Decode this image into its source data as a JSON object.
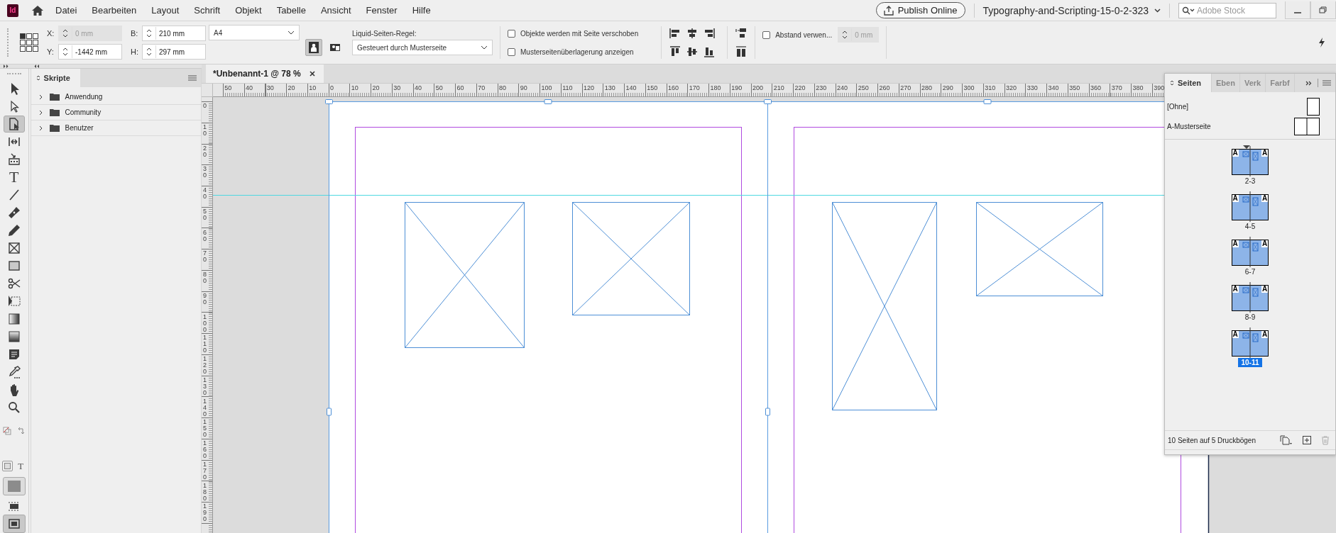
{
  "app_icon": {
    "label": "Id"
  },
  "menu": [
    "Datei",
    "Bearbeiten",
    "Layout",
    "Schrift",
    "Objekt",
    "Tabelle",
    "Ansicht",
    "Fenster",
    "Hilfe"
  ],
  "publish_button": "Publish Online",
  "document_switcher": "Typography-and-Scripting-15-0-2-323",
  "search": {
    "placeholder": "Adobe Stock"
  },
  "control_panel": {
    "fields": [
      {
        "label": "X:",
        "value": "0 mm",
        "disabled": true
      },
      {
        "label": "Y:",
        "value": "-1442 mm",
        "disabled": false
      },
      {
        "label": "B:",
        "value": "210 mm",
        "disabled": false
      },
      {
        "label": "H:",
        "value": "297 mm",
        "disabled": false
      }
    ],
    "preset": "A4",
    "orientation": [
      {
        "kind": "portrait",
        "selected": true
      },
      {
        "kind": "landscape",
        "selected": false
      }
    ],
    "liquid_label": "Liquid-Seiten-Regel:",
    "liquid_rule": "Gesteuert durch Musterseite",
    "options": [
      {
        "label": "Objekte werden mit Seite verschoben",
        "checked": false
      },
      {
        "label": "Musterseitenüberlagerung anzeigen",
        "checked": false
      }
    ],
    "spacing": {
      "label": "Abstand verwen...",
      "checked": false,
      "value": "0 mm",
      "disabled": true
    }
  },
  "tools": [
    {
      "kind": "selection",
      "selected": false
    },
    {
      "kind": "direct-selection",
      "selected": false
    },
    {
      "kind": "page",
      "selected": true
    },
    {
      "kind": "gap",
      "selected": false
    },
    {
      "kind": "content-collector",
      "selected": false
    },
    {
      "kind": "type",
      "glyph": "T",
      "selected": false
    },
    {
      "kind": "line",
      "selected": false
    },
    {
      "kind": "pen",
      "selected": false
    },
    {
      "kind": "pencil",
      "selected": false
    },
    {
      "kind": "rectangle-frame",
      "selected": false
    },
    {
      "kind": "rectangle",
      "selected": false
    },
    {
      "kind": "scissors",
      "selected": false
    },
    {
      "kind": "free-transform",
      "selected": false
    },
    {
      "kind": "gradient",
      "selected": false
    },
    {
      "kind": "gradient-feather",
      "selected": false
    },
    {
      "kind": "note",
      "selected": false
    },
    {
      "kind": "eyedropper",
      "selected": false
    },
    {
      "kind": "hand",
      "selected": false
    },
    {
      "kind": "zoom",
      "selected": false
    }
  ],
  "format_toggle": [
    {
      "kind": "container",
      "selected": true
    },
    {
      "kind": "text",
      "glyph": "T",
      "selected": false
    }
  ],
  "screen_mode": {
    "selected": true
  },
  "scripts_panel": {
    "tab": "Skripte",
    "items": [
      {
        "label": "Anwendung",
        "expanded": false
      },
      {
        "label": "Community",
        "expanded": false
      },
      {
        "label": "Benutzer",
        "expanded": false
      }
    ]
  },
  "document_tab": {
    "title": "*Unbenannt-1 @ 78 %"
  },
  "rulers": {
    "horizontal": [
      "50",
      "40",
      "30",
      "20",
      "10",
      "0",
      "10",
      "20",
      "30",
      "40",
      "50",
      "60",
      "70",
      "80",
      "90",
      "100",
      "110",
      "120",
      "130",
      "140",
      "150",
      "160",
      "170",
      "180",
      "190",
      "200",
      "210",
      "220",
      "230",
      "240",
      "250",
      "260",
      "270",
      "280",
      "290",
      "300",
      "310",
      "320",
      "330",
      "340",
      "350",
      "360",
      "370",
      "380",
      "390"
    ],
    "vertical": [
      "0",
      "10",
      "20",
      "30",
      "40",
      "50",
      "60",
      "70",
      "80",
      "90",
      "100",
      "110",
      "120",
      "130",
      "140",
      "150",
      "160",
      "170",
      "180",
      "190"
    ]
  },
  "pages_panel": {
    "tabs": [
      {
        "label": "Seiten",
        "selected": true
      },
      {
        "label": "Eben",
        "selected": false
      },
      {
        "label": "Verk",
        "selected": false
      },
      {
        "label": "Farbf",
        "selected": false
      }
    ],
    "masters": [
      {
        "label": "[Ohne]",
        "kind": "single"
      },
      {
        "label": "A-Musterseite",
        "kind": "spread"
      }
    ],
    "spreads": [
      {
        "label": "2-3",
        "master_letters": [
          "A",
          "A"
        ],
        "pointer": true,
        "selected": false
      },
      {
        "label": "4-5",
        "master_letters": [
          "A",
          "A"
        ],
        "pointer": false,
        "selected": false
      },
      {
        "label": "6-7",
        "master_letters": [
          "A",
          "A"
        ],
        "pointer": false,
        "selected": false
      },
      {
        "label": "8-9",
        "master_letters": [
          "A",
          "A"
        ],
        "pointer": false,
        "selected": false
      },
      {
        "label": "10-11",
        "master_letters": [
          "A",
          "A"
        ],
        "pointer": false,
        "selected": true
      }
    ],
    "status": "10 Seiten auf 5 Druckbögen"
  }
}
